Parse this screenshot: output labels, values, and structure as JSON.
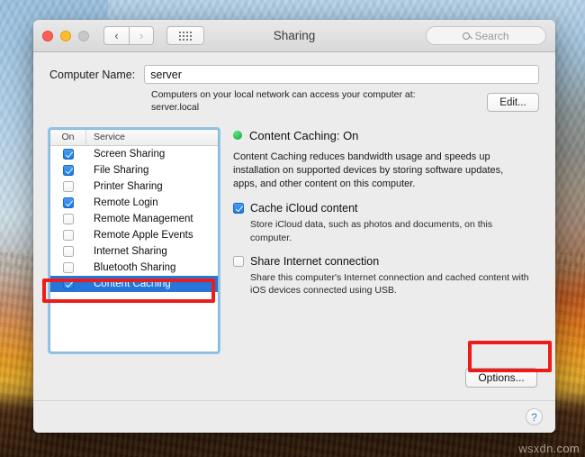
{
  "window": {
    "title": "Sharing",
    "traffic_lights": [
      "close",
      "minimize",
      "maximize"
    ],
    "nav_back": "‹",
    "nav_forward": "›",
    "show_all_icon": "grid-icon",
    "search": {
      "placeholder": "Search",
      "value": "",
      "icon": "search-icon"
    }
  },
  "computer_name": {
    "label": "Computer Name:",
    "value": "server",
    "help_line1": "Computers on your local network can access your computer at:",
    "help_line2": "server.local",
    "edit_button": "Edit..."
  },
  "services_list": {
    "columns": [
      "On",
      "Service"
    ],
    "rows": [
      {
        "name": "Screen Sharing",
        "on": true,
        "selected": false
      },
      {
        "name": "File Sharing",
        "on": true,
        "selected": false
      },
      {
        "name": "Printer Sharing",
        "on": false,
        "selected": false
      },
      {
        "name": "Remote Login",
        "on": true,
        "selected": false
      },
      {
        "name": "Remote Management",
        "on": false,
        "selected": false
      },
      {
        "name": "Remote Apple Events",
        "on": false,
        "selected": false
      },
      {
        "name": "Internet Sharing",
        "on": false,
        "selected": false
      },
      {
        "name": "Bluetooth Sharing",
        "on": false,
        "selected": false
      },
      {
        "name": "Content Caching",
        "on": true,
        "selected": true
      }
    ]
  },
  "detail": {
    "status_label": "Content Caching: On",
    "status_color": "#1fbc45",
    "description": "Content Caching reduces bandwidth usage and speeds up installation on supported devices by storing software updates, apps, and other content on this computer.",
    "options": [
      {
        "title": "Cache iCloud content",
        "checked": true,
        "subtitle": "Store iCloud data, such as photos and documents, on this computer."
      },
      {
        "title": "Share Internet connection",
        "checked": false,
        "subtitle": "Share this computer's Internet connection and cached content with iOS devices connected using USB."
      }
    ],
    "options_button": "Options..."
  },
  "footer": {
    "help_label": "?"
  },
  "annotations": {
    "color": "#ee1c18",
    "targets": [
      "content-caching-row",
      "options-button"
    ]
  },
  "desktop": {
    "watermark": "wsxdn.com"
  }
}
